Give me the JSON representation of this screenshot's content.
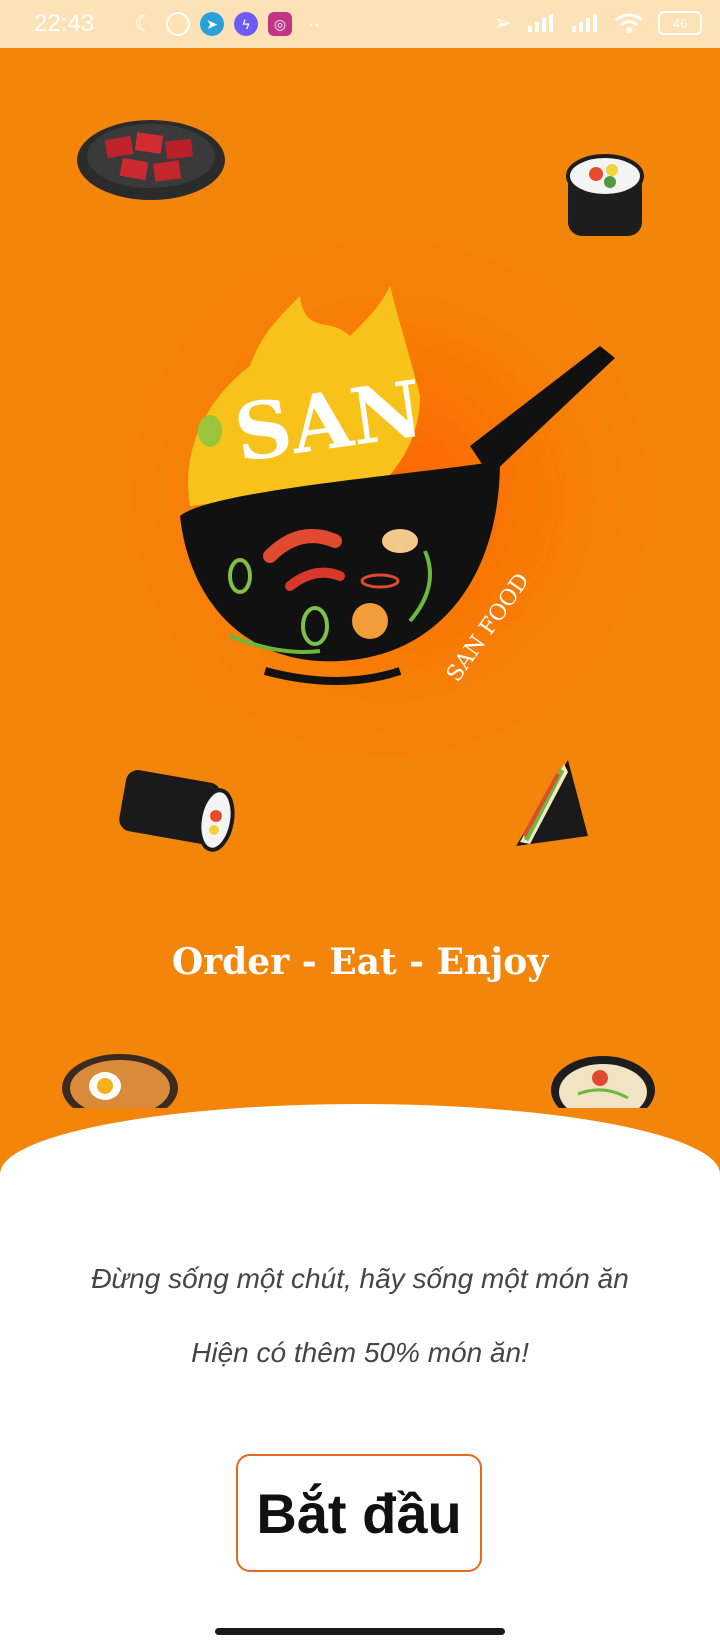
{
  "status_bar": {
    "time": "22:43",
    "left_icons": [
      "moon-icon",
      "alarm-icon",
      "telegram-icon",
      "messenger-icon",
      "instagram-icon",
      "more-dots-icon"
    ],
    "right_icons": [
      "location-arrow-icon",
      "signal-icon",
      "signal-icon",
      "wifi-icon"
    ],
    "battery": "46"
  },
  "logo": {
    "brand": "SAN",
    "brand_sub": "SAN FOOD"
  },
  "tagline": "Order - Eat - Enjoy",
  "sheet": {
    "line1": "Đừng sống một chút, hãy sống một món ăn",
    "line2": "Hiện có thêm 50% món ăn!",
    "start_label": "Bắt đầu"
  },
  "colors": {
    "background": "#F3860A",
    "status_bar": "#FDE2B8",
    "button_border": "#E46A1E",
    "sheet": "#FFFFFF"
  }
}
